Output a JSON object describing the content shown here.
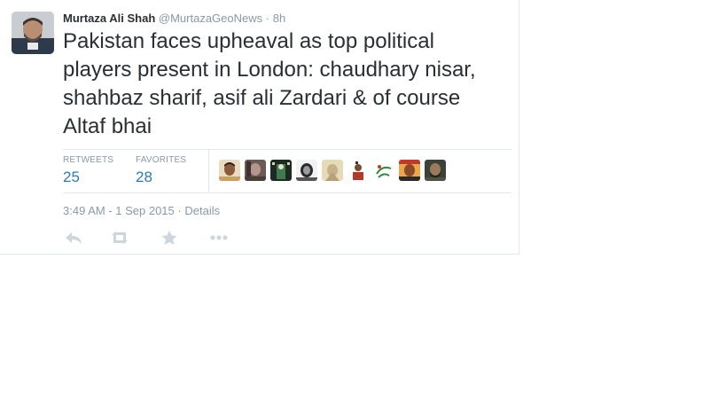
{
  "tweet": {
    "fullname": "Murtaza Ali Shah",
    "username": "@MurtazaGeoNews",
    "separator": "·",
    "time": "8h",
    "text": "Pakistan faces upheaval as top political players present in London: chaudhary nisar, shahbaz sharif, asif ali Zardari & of course Altaf bhai",
    "stats": {
      "retweets_label": "RETWEETS",
      "retweets_value": "25",
      "favorites_label": "FAVORITES",
      "favorites_value": "28"
    },
    "timestamp": "3:49 AM - 1 Sep 2015",
    "meta_separator": "·",
    "details_link": "Details",
    "actions": [
      {
        "icon": "reply-icon"
      },
      {
        "icon": "retweet-icon"
      },
      {
        "icon": "favorite-star-icon"
      },
      {
        "icon": "more-options-icon"
      }
    ],
    "favoriters_count_shown": 9
  },
  "colors": {
    "text": "#292f33",
    "muted": "#8899a6",
    "link_blue": "#2b7bb9",
    "border": "#e1e8ed",
    "action_icon": "#ccd6dd"
  }
}
